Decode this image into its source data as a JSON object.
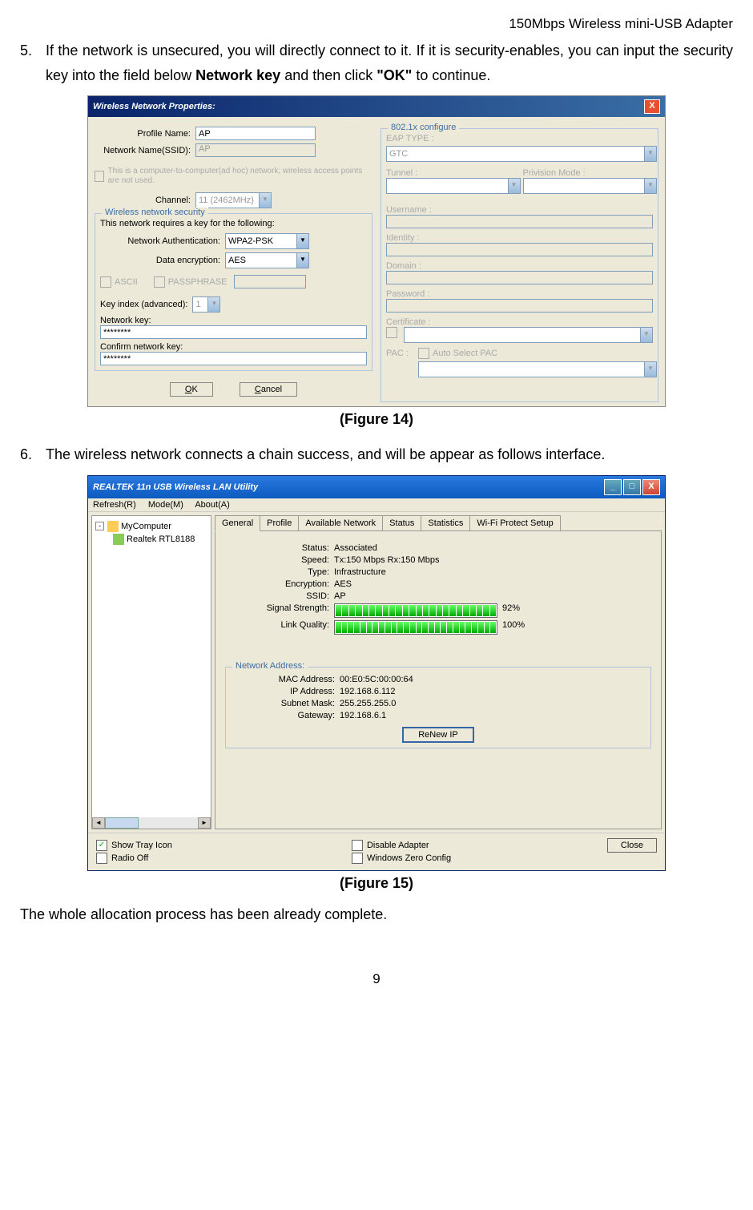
{
  "header": "150Mbps Wireless mini-USB Adapter",
  "steps": {
    "s5": {
      "num": "5.",
      "text_a": "If the network is unsecured, you will directly connect to it. If it is security-enables, you can input the security key into the field below ",
      "bold1": "Network key",
      "text_b": " and then click ",
      "bold2": "\"OK\"",
      "text_c": " to continue."
    },
    "s6": {
      "num": "6.",
      "text": "The wireless network connects a chain success, and will be appear as follows interface."
    }
  },
  "fig14": {
    "caption": "(Figure 14)",
    "title": "Wireless Network Properties:",
    "profile_name_label": "Profile Name:",
    "profile_name_value": "AP",
    "ssid_label": "Network Name(SSID):",
    "ssid_value": "AP",
    "adhoc_text": "This is a computer-to-computer(ad hoc) network; wireless access points are not used.",
    "channel_label": "Channel:",
    "channel_value": "11 (2462MHz)",
    "security_legend": "Wireless network security",
    "security_text": "This network requires a key for the following:",
    "net_auth_label": "Network Authentication:",
    "net_auth_value": "WPA2-PSK",
    "data_enc_label": "Data encryption:",
    "data_enc_value": "AES",
    "ascii_label": "ASCII",
    "passphrase_label": "PASSPHRASE",
    "key_index_label": "Key index (advanced):",
    "key_index_value": "1",
    "net_key_label": "Network key:",
    "net_key_value": "********",
    "confirm_key_label": "Confirm network key:",
    "confirm_key_value": "********",
    "ok_btn": "OK",
    "cancel_btn": "Cancel",
    "x802_legend": "802.1x configure",
    "eap_type_label": "EAP TYPE :",
    "eap_type_value": "GTC",
    "tunnel_label": "Tunnel :",
    "privision_label": "Privision Mode :",
    "username_label": "Username :",
    "identity_label": "Identity :",
    "domain_label": "Domain :",
    "password_label": "Password :",
    "certificate_label": "Certificate :",
    "pac_label": "PAC :",
    "auto_pac_label": "Auto Select PAC"
  },
  "fig15": {
    "caption": "(Figure 15)",
    "title": "REALTEK 11n USB Wireless LAN Utility",
    "menu": {
      "refresh": "Refresh(R)",
      "mode": "Mode(M)",
      "about": "About(A)"
    },
    "tree": {
      "mycomputer": "MyComputer",
      "device": "Realtek RTL8188"
    },
    "tabs": [
      "General",
      "Profile",
      "Available Network",
      "Status",
      "Statistics",
      "Wi-Fi Protect Setup"
    ],
    "general": {
      "status_label": "Status:",
      "status_value": "Associated",
      "speed_label": "Speed:",
      "speed_value": "Tx:150 Mbps Rx:150 Mbps",
      "type_label": "Type:",
      "type_value": "Infrastructure",
      "encryption_label": "Encryption:",
      "encryption_value": "AES",
      "ssid_label": "SSID:",
      "ssid_value": "AP",
      "signal_label": "Signal Strength:",
      "signal_value": "92%",
      "link_label": "Link Quality:",
      "link_value": "100%"
    },
    "netaddr": {
      "legend": "Network Address:",
      "mac_label": "MAC Address:",
      "mac_value": "00:E0:5C:00:00:64",
      "ip_label": "IP Address:",
      "ip_value": "192.168.6.112",
      "subnet_label": "Subnet Mask:",
      "subnet_value": "255.255.255.0",
      "gateway_label": "Gateway:",
      "gateway_value": "192.168.6.1",
      "renew_btn": "ReNew IP"
    },
    "bottom": {
      "show_tray": "Show Tray Icon",
      "radio_off": "Radio Off",
      "disable_adapter": "Disable Adapter",
      "windows_zero": "Windows Zero Config",
      "close_btn": "Close"
    }
  },
  "conclusion": "The whole allocation process has been already complete.",
  "page_num": "9"
}
